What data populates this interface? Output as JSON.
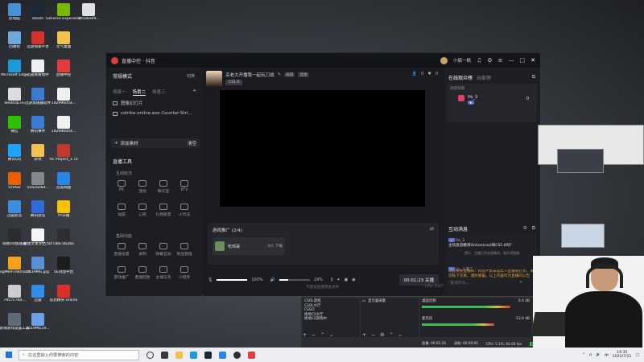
{
  "desktop_icons": [
    {
      "label": "此电脑",
      "color": "#4a90d9"
    },
    {
      "label": "steam",
      "color": "#1b2838"
    },
    {
      "label": "GeForce Experience",
      "color": "#76b900"
    },
    {
      "label": "345a6ed9...",
      "color": "#e0e0e0"
    },
    {
      "label": "回收站",
      "color": "#6fa8dc"
    },
    {
      "label": "迅游加速平台",
      "color": "#d9302b"
    },
    {
      "label": "元气桌面",
      "color": "#f2c14e"
    },
    {
      "label": "Microsoft Edge",
      "color": "#1c9bd8"
    },
    {
      "label": "迅雷看看组件",
      "color": "#f0f0f0"
    },
    {
      "label": "直播中控",
      "color": "#e23d3d"
    },
    {
      "label": "desktop.ini",
      "color": "#dcdcdc"
    },
    {
      "label": "迅游加速器软件",
      "color": "#3b7bd4"
    },
    {
      "label": "142996054...",
      "color": "#f0f0f0"
    },
    {
      "label": "微信",
      "color": "#2dc100"
    },
    {
      "label": "腾讯事件",
      "color": "#3a7bd5"
    },
    {
      "label": "142996054...",
      "color": "#f0f0f0"
    },
    {
      "label": "腾讯QQ",
      "color": "#1aa3ff"
    },
    {
      "label": "杂项",
      "color": "#f2c14e"
    },
    {
      "label": "VE Project_1.7z",
      "color": "#c0392b"
    },
    {
      "label": "Firefox",
      "color": "#e66000"
    },
    {
      "label": "55a2acbd...",
      "color": "#888888"
    },
    {
      "label": "百度网盘",
      "color": "#2b85e4"
    },
    {
      "label": "迅雷影音",
      "color": "#3b8ee0"
    },
    {
      "label": "腾讯会议",
      "color": "#2f6bd9"
    },
    {
      "label": "YY开播",
      "color": "#f5c400"
    },
    {
      "label": "网易UU加速器",
      "color": "#2c2c2c"
    },
    {
      "label": "新建文本文档.txt",
      "color": "#f5f5f5"
    },
    {
      "label": "OBS Studio",
      "color": "#302e31"
    },
    {
      "label": "LogMeIn Hamachi",
      "color": "#f7a11a"
    },
    {
      "label": "2519MG.jpg",
      "color": "#5a8fd6"
    },
    {
      "label": "5E对战平台",
      "color": "#1c1c1c"
    },
    {
      "label": "7957c76d...",
      "color": "#cccccc"
    },
    {
      "label": "迅雷",
      "color": "#2f8ee6"
    },
    {
      "label": "反恐精英 Online",
      "color": "#d9302b"
    },
    {
      "label": "新增游戏设置工具",
      "color": "#5f6b7a"
    },
    {
      "label": "2519MG34...",
      "color": "#6aa0e6"
    }
  ],
  "app": {
    "title": "直播中控 · 抖音",
    "username": "小狐一枫",
    "window_controls": [
      "close"
    ]
  },
  "left_panel": {
    "mode_title": "常规模式",
    "mode_action": "切换",
    "scene_tabs": [
      "场景一",
      "场景二",
      "场景三"
    ],
    "active_tab": 1,
    "sources": [
      "图像幻灯片",
      "cstrike-online.exe Counter-Stri..."
    ],
    "add_source": "添加素材",
    "clear": "清空",
    "tools_title": "直播工具",
    "interact_title": "互动玩法",
    "interact_tools": [
      "PK",
      "连线",
      "聊天室",
      "KTV",
      "福袋",
      "心愿",
      "礼物投票",
      "小玩法"
    ],
    "basic_title": "基础功能",
    "basic_tools": [
      "直播设置",
      "录制",
      "弹幕互动",
      "商品管理",
      "游戏推广",
      "直播回放",
      "主播任务",
      "小程序"
    ]
  },
  "center": {
    "stream_title": "买老大开播我一起玩刀战",
    "badges": [
      "编辑",
      "直播"
    ],
    "tag": "CS1.6",
    "viewers": "0",
    "likes": "0",
    "promo_title": "游戏推广 (2/4)",
    "promo_item_name": "吃鸡哥",
    "promo_item_count": "8人 下载",
    "mic_volume": "100%",
    "speaker_volume": "29%",
    "timer": "00:01:23",
    "live_label": "关播",
    "status_left": "不建议您使用此文件",
    "cpu": "CPU: 3.67%",
    "memory": "内存: 34.75%",
    "fps": "帧率: 60fps",
    "bitrate": "码率: 219kbps"
  },
  "right_panel": {
    "online_title": "在线观众榜",
    "fans_title": "玩家榜",
    "online_sub": "高级观看",
    "viewer_name": "Hs_3",
    "viewer_score": "0",
    "interact_title": "互动消息",
    "welcome": "提示：主播已开启直播间，请文明直播",
    "notice": "欢迎来到直播间！抖音严禁未成年人直播或打赏，请勿私下交易，谨防受骗。以上内容均为直播间公告",
    "chat_user": "Hs_3",
    "chat_msg": "主玩反恐精英Online(cso)和CS1.6吗？",
    "chat_follow": "Hs_3 来了",
    "input_placeholder": "说点什么..."
  },
  "obs": {
    "scenes": [
      "CSOL游戏",
      "CSOL大厅",
      "CSGO",
      "绝地CS大厅",
      "绝地CS游戏中"
    ],
    "sources": [
      "显示器采集"
    ],
    "mixer": [
      {
        "name": "桌面音频",
        "db": "0.0 dB"
      },
      {
        "name": "麦克风",
        "db": "-13.0 dB"
      }
    ],
    "status": [
      "直播: 00:01:24",
      "录制: 00:00:00",
      "CPU: 5.1%, 60.00 fps",
      "kb/s: 8014"
    ]
  },
  "taskbar": {
    "search_placeholder": "在这里输入你要搜索的内容",
    "time": "19:35",
    "date": "2022/7/21",
    "lang": "中"
  }
}
